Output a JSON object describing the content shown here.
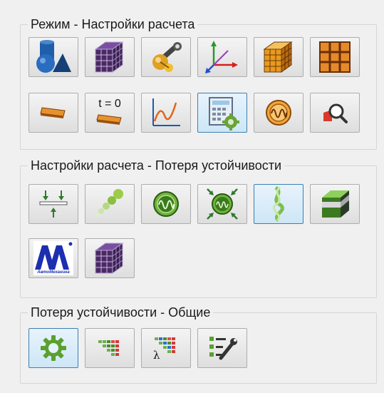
{
  "groups": [
    {
      "title": "Режим - Настройки расчета"
    },
    {
      "title": "Настройки расчета - Потеря устойчивости"
    },
    {
      "title": "Потеря устойчивости - Общие"
    }
  ],
  "icon_text": {
    "t0": "t = 0",
    "lambda": "λ",
    "logo": "АвтоМеханика"
  },
  "colors": {
    "active_border": "#3c7fb1",
    "button_border": "#adadad",
    "accent_orange": "#e58a2a",
    "accent_green": "#4a8c2a"
  }
}
